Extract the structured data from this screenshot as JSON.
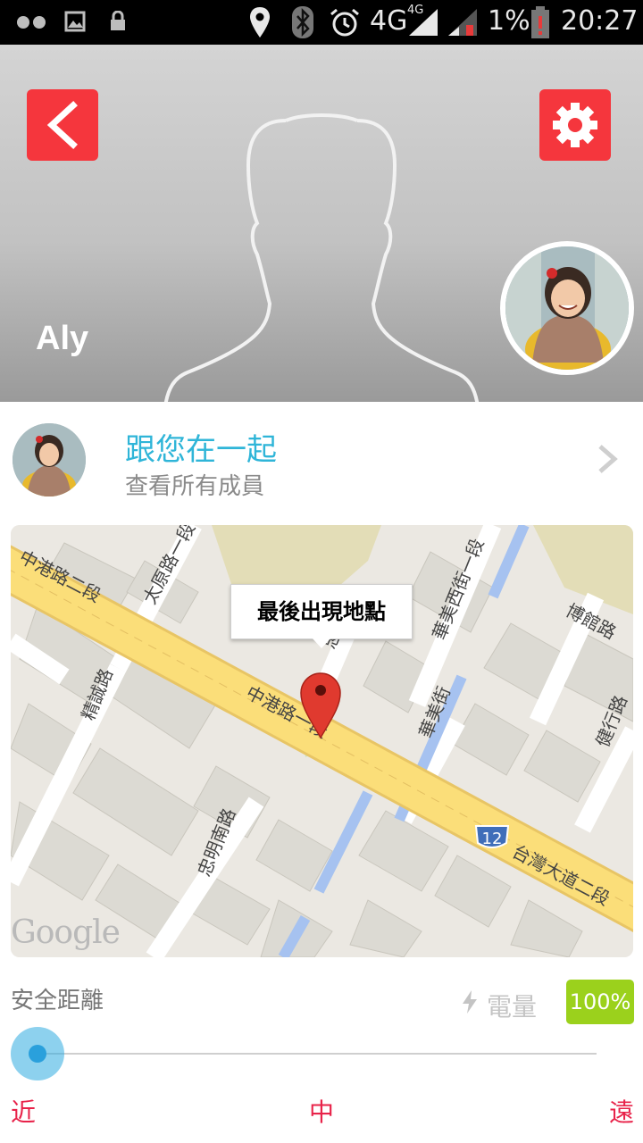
{
  "status_bar": {
    "network": "4G",
    "network_small": "4G",
    "battery_percent": "1%",
    "time": "20:27"
  },
  "header": {
    "user_name": "Aly"
  },
  "members": {
    "title": "跟您在一起",
    "subtitle": "查看所有成員"
  },
  "map": {
    "callout": "最後出現地點",
    "logo": "Google",
    "road_shield": "12",
    "streets": [
      "中港路二段",
      "太原路一段",
      "華美西街一段",
      "博館路",
      "忠明",
      "精誠路",
      "中港路一段",
      "華美街",
      "健行路",
      "忠明南路",
      "台灣大道二段"
    ]
  },
  "controls": {
    "distance_label": "安全距離",
    "battery_label": "電量",
    "battery_value": "100%",
    "slider_level": 0,
    "scale": {
      "near": "近",
      "mid": "中",
      "far": "遠"
    }
  },
  "colors": {
    "accent_red": "#f5363d",
    "accent_blue": "#2fb5d8",
    "battery_green": "#9bd11c",
    "scale_red": "#e8234a"
  }
}
